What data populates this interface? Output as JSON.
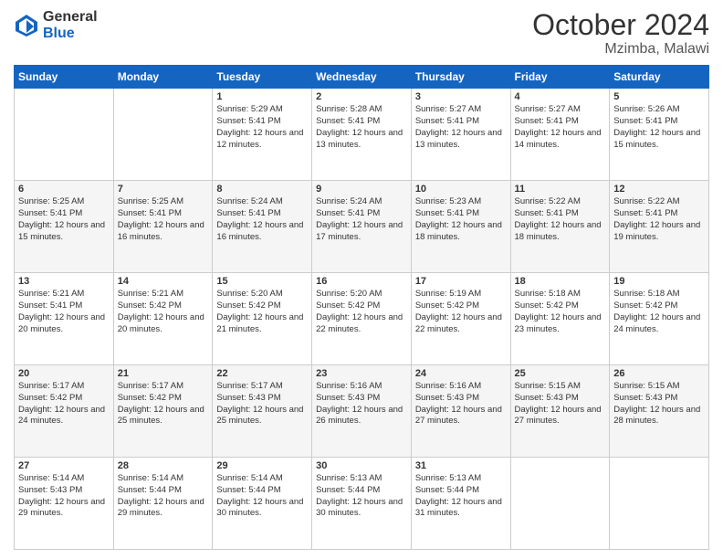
{
  "logo": {
    "general": "General",
    "blue": "Blue"
  },
  "header": {
    "month": "October 2024",
    "location": "Mzimba, Malawi"
  },
  "days_of_week": [
    "Sunday",
    "Monday",
    "Tuesday",
    "Wednesday",
    "Thursday",
    "Friday",
    "Saturday"
  ],
  "weeks": [
    [
      {
        "day": "",
        "info": ""
      },
      {
        "day": "",
        "info": ""
      },
      {
        "day": "1",
        "info": "Sunrise: 5:29 AM\nSunset: 5:41 PM\nDaylight: 12 hours\nand 12 minutes."
      },
      {
        "day": "2",
        "info": "Sunrise: 5:28 AM\nSunset: 5:41 PM\nDaylight: 12 hours\nand 13 minutes."
      },
      {
        "day": "3",
        "info": "Sunrise: 5:27 AM\nSunset: 5:41 PM\nDaylight: 12 hours\nand 13 minutes."
      },
      {
        "day": "4",
        "info": "Sunrise: 5:27 AM\nSunset: 5:41 PM\nDaylight: 12 hours\nand 14 minutes."
      },
      {
        "day": "5",
        "info": "Sunrise: 5:26 AM\nSunset: 5:41 PM\nDaylight: 12 hours\nand 15 minutes."
      }
    ],
    [
      {
        "day": "6",
        "info": "Sunrise: 5:25 AM\nSunset: 5:41 PM\nDaylight: 12 hours\nand 15 minutes."
      },
      {
        "day": "7",
        "info": "Sunrise: 5:25 AM\nSunset: 5:41 PM\nDaylight: 12 hours\nand 16 minutes."
      },
      {
        "day": "8",
        "info": "Sunrise: 5:24 AM\nSunset: 5:41 PM\nDaylight: 12 hours\nand 16 minutes."
      },
      {
        "day": "9",
        "info": "Sunrise: 5:24 AM\nSunset: 5:41 PM\nDaylight: 12 hours\nand 17 minutes."
      },
      {
        "day": "10",
        "info": "Sunrise: 5:23 AM\nSunset: 5:41 PM\nDaylight: 12 hours\nand 18 minutes."
      },
      {
        "day": "11",
        "info": "Sunrise: 5:22 AM\nSunset: 5:41 PM\nDaylight: 12 hours\nand 18 minutes."
      },
      {
        "day": "12",
        "info": "Sunrise: 5:22 AM\nSunset: 5:41 PM\nDaylight: 12 hours\nand 19 minutes."
      }
    ],
    [
      {
        "day": "13",
        "info": "Sunrise: 5:21 AM\nSunset: 5:41 PM\nDaylight: 12 hours\nand 20 minutes."
      },
      {
        "day": "14",
        "info": "Sunrise: 5:21 AM\nSunset: 5:42 PM\nDaylight: 12 hours\nand 20 minutes."
      },
      {
        "day": "15",
        "info": "Sunrise: 5:20 AM\nSunset: 5:42 PM\nDaylight: 12 hours\nand 21 minutes."
      },
      {
        "day": "16",
        "info": "Sunrise: 5:20 AM\nSunset: 5:42 PM\nDaylight: 12 hours\nand 22 minutes."
      },
      {
        "day": "17",
        "info": "Sunrise: 5:19 AM\nSunset: 5:42 PM\nDaylight: 12 hours\nand 22 minutes."
      },
      {
        "day": "18",
        "info": "Sunrise: 5:18 AM\nSunset: 5:42 PM\nDaylight: 12 hours\nand 23 minutes."
      },
      {
        "day": "19",
        "info": "Sunrise: 5:18 AM\nSunset: 5:42 PM\nDaylight: 12 hours\nand 24 minutes."
      }
    ],
    [
      {
        "day": "20",
        "info": "Sunrise: 5:17 AM\nSunset: 5:42 PM\nDaylight: 12 hours\nand 24 minutes."
      },
      {
        "day": "21",
        "info": "Sunrise: 5:17 AM\nSunset: 5:42 PM\nDaylight: 12 hours\nand 25 minutes."
      },
      {
        "day": "22",
        "info": "Sunrise: 5:17 AM\nSunset: 5:43 PM\nDaylight: 12 hours\nand 25 minutes."
      },
      {
        "day": "23",
        "info": "Sunrise: 5:16 AM\nSunset: 5:43 PM\nDaylight: 12 hours\nand 26 minutes."
      },
      {
        "day": "24",
        "info": "Sunrise: 5:16 AM\nSunset: 5:43 PM\nDaylight: 12 hours\nand 27 minutes."
      },
      {
        "day": "25",
        "info": "Sunrise: 5:15 AM\nSunset: 5:43 PM\nDaylight: 12 hours\nand 27 minutes."
      },
      {
        "day": "26",
        "info": "Sunrise: 5:15 AM\nSunset: 5:43 PM\nDaylight: 12 hours\nand 28 minutes."
      }
    ],
    [
      {
        "day": "27",
        "info": "Sunrise: 5:14 AM\nSunset: 5:43 PM\nDaylight: 12 hours\nand 29 minutes."
      },
      {
        "day": "28",
        "info": "Sunrise: 5:14 AM\nSunset: 5:44 PM\nDaylight: 12 hours\nand 29 minutes."
      },
      {
        "day": "29",
        "info": "Sunrise: 5:14 AM\nSunset: 5:44 PM\nDaylight: 12 hours\nand 30 minutes."
      },
      {
        "day": "30",
        "info": "Sunrise: 5:13 AM\nSunset: 5:44 PM\nDaylight: 12 hours\nand 30 minutes."
      },
      {
        "day": "31",
        "info": "Sunrise: 5:13 AM\nSunset: 5:44 PM\nDaylight: 12 hours\nand 31 minutes."
      },
      {
        "day": "",
        "info": ""
      },
      {
        "day": "",
        "info": ""
      }
    ]
  ]
}
